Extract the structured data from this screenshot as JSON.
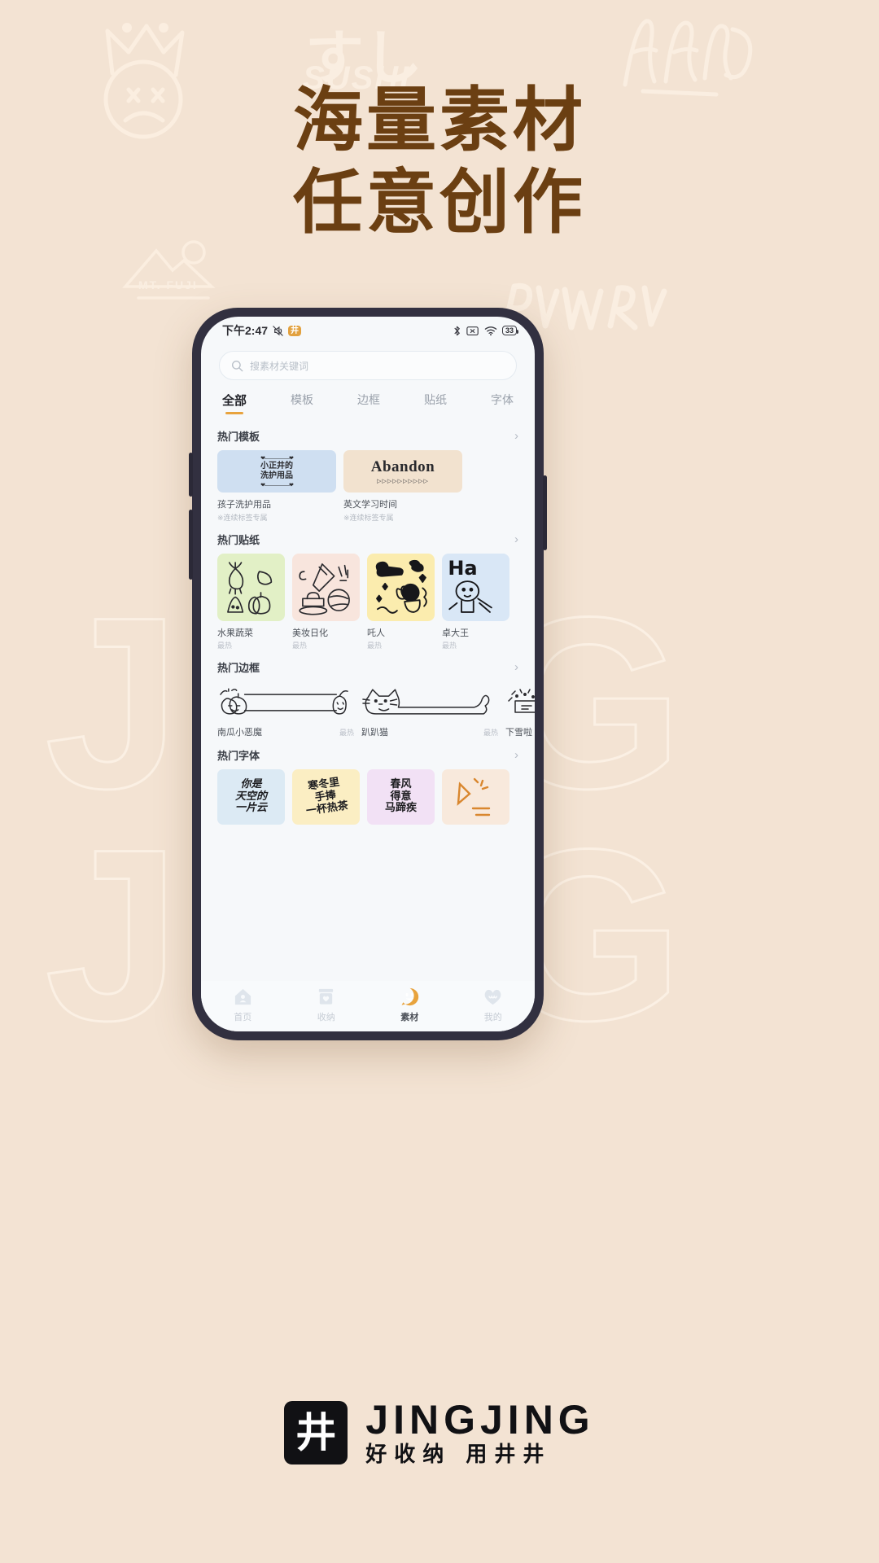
{
  "poster": {
    "background_color": "#f3e3d3",
    "headline_color": "#6b3f12",
    "headline_line1": "海量素材",
    "headline_line2": "任意创作",
    "deco_sushi_jp": "すし",
    "deco_sushi_en": "SUSHI",
    "watermark_line1": "JING",
    "watermark_line2": "JING"
  },
  "footer": {
    "logo_glyph": "井",
    "brand_en": "JINGJING",
    "brand_cn": "好收纳 用井井"
  },
  "phone": {
    "statusbar": {
      "time": "下午2:47",
      "mute_icon": "mute-icon",
      "app_badge": "井",
      "bluetooth_icon": "bluetooth-icon",
      "sim_icon": "sim-off-icon",
      "wifi_icon": "wifi-icon",
      "battery_level": "33"
    },
    "search": {
      "icon": "search-icon",
      "placeholder": "搜素材关键词",
      "value": ""
    },
    "tabs": [
      {
        "label": "全部",
        "active": true
      },
      {
        "label": "模板",
        "active": false
      },
      {
        "label": "边框",
        "active": false
      },
      {
        "label": "贴纸",
        "active": false
      },
      {
        "label": "字体",
        "active": false
      }
    ],
    "sections": {
      "templates": {
        "title": "热门模板",
        "more_icon": "chevron-right-icon",
        "items": [
          {
            "thumb_line1": "小正井的",
            "thumb_line2": "洗护用品",
            "name": "孩子洗护用品",
            "sub": "※连续标签专属"
          },
          {
            "thumb_text": "Abandon",
            "name": "英文学习时间",
            "sub": "※连续标签专属"
          }
        ]
      },
      "stickers": {
        "title": "热门贴纸",
        "more_icon": "chevron-right-icon",
        "items": [
          {
            "name": "水果蔬菜",
            "hot": "最热"
          },
          {
            "name": "美妆日化",
            "hot": "最热"
          },
          {
            "name": "吒人",
            "hot": "最热"
          },
          {
            "name": "卓大王",
            "hot": "最热"
          }
        ]
      },
      "borders": {
        "title": "热门边框",
        "more_icon": "chevron-right-icon",
        "items": [
          {
            "name": "南瓜小恶魔",
            "hot": "最热"
          },
          {
            "name": "趴趴猫",
            "hot": "最热"
          },
          {
            "name": "下雪啦",
            "hot": ""
          }
        ]
      },
      "fonts": {
        "title": "热门字体",
        "more_icon": "chevron-right-icon",
        "items": [
          {
            "preview": "你是\n天空的\n一片云"
          },
          {
            "preview": "寒冬里\n手捧\n一杯热茶"
          },
          {
            "preview": "春风\n得意\n马蹄疾"
          },
          {
            "preview": ""
          }
        ]
      }
    },
    "bottom_nav": [
      {
        "label": "首页",
        "icon": "home-icon",
        "active": false
      },
      {
        "label": "收纳",
        "icon": "box-heart-icon",
        "active": false
      },
      {
        "label": "素材",
        "icon": "smiley-icon",
        "active": true
      },
      {
        "label": "我的",
        "icon": "heart-icon",
        "active": false
      }
    ],
    "accent_color": "#e8a33d"
  }
}
